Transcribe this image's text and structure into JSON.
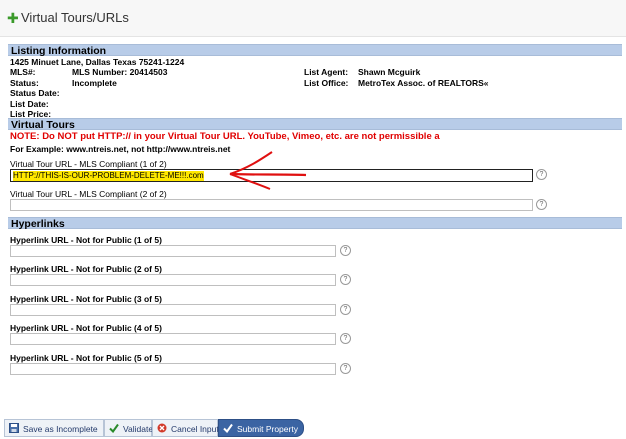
{
  "header": {
    "title": "Virtual Tours/URLs"
  },
  "listing": {
    "section": "Listing Information",
    "address": "1425 Minuet Lane, Dallas Texas 75241-1224",
    "mls_label": "MLS#:",
    "mls_value": "MLS Number: 20414503",
    "status_label": "Status:",
    "status_value": "Incomplete",
    "status_date_label": "Status Date:",
    "list_date_label": "List Date:",
    "list_price_label": "List Price:",
    "agent_label": "List Agent:",
    "agent_value": "Shawn Mcguirk",
    "office_label": "List Office:",
    "office_value": "MetroTex Assoc. of REALTORS«"
  },
  "virtual_tours": {
    "section": "Virtual Tours",
    "note": "NOTE: Do NOT put HTTP:// in your Virtual Tour URL. YouTube, Vimeo, etc. are not permissible a",
    "example": "For Example: www.ntreis.net, not http://www.ntreis.net",
    "field1_label": "Virtual Tour URL - MLS Compliant (1 of 2)",
    "field1_value": "HTTP://THIS-IS-OUR-PROBLEM-DELETE-ME!!!.com",
    "field2_label": "Virtual Tour URL - MLS Compliant (2 of 2)",
    "field2_value": ""
  },
  "hyperlinks": {
    "section": "Hyperlinks",
    "items": [
      {
        "label": "Hyperlink URL - Not for Public (1 of 5)",
        "value": ""
      },
      {
        "label": "Hyperlink URL - Not for Public (2 of 5)",
        "value": ""
      },
      {
        "label": "Hyperlink URL - Not for Public (3 of 5)",
        "value": ""
      },
      {
        "label": "Hyperlink URL - Not for Public (4 of 5)",
        "value": ""
      },
      {
        "label": "Hyperlink URL - Not for Public (5 of 5)",
        "value": ""
      }
    ]
  },
  "help_glyph": "?",
  "footer": {
    "save_incomplete": "Save as Incomplete",
    "validate": "Validate",
    "cancel": "Cancel Input",
    "submit": "Submit Property"
  },
  "colors": {
    "section_band": "#b8cce8",
    "note_red": "#e00000",
    "highlight": "#ffe800",
    "arrow_red": "#e01010",
    "submit_blue": "#3b64a3"
  }
}
